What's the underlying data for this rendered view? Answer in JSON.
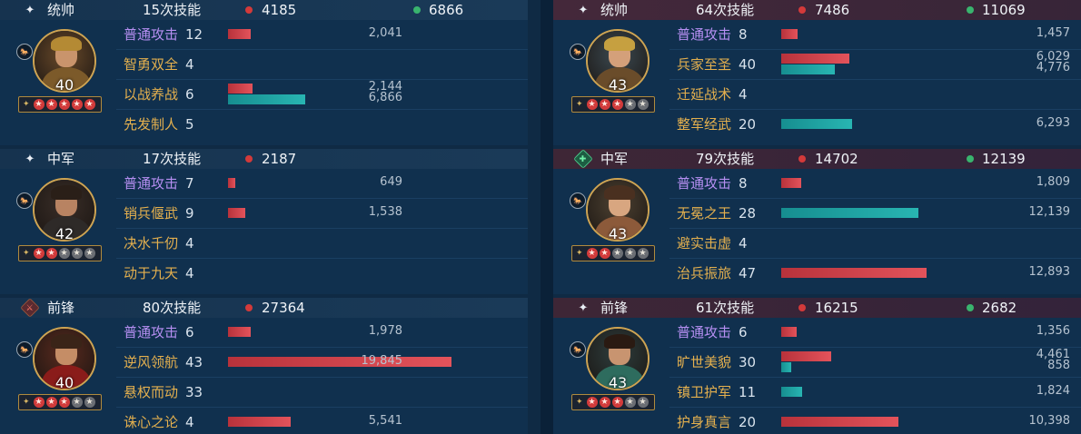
{
  "star_colors": {
    "on": "#d23b3b",
    "off": "#6b6e74"
  },
  "bar_colors": {
    "damage": "#d43a3a",
    "heal": "#1fa3a3"
  },
  "left": [
    {
      "role": "统帅",
      "role_icon": "sparkle-icon",
      "skills": "15次技能",
      "damage": "4185",
      "heal": "6866",
      "level": "40",
      "stars_on": 5,
      "stars_total": 5,
      "rows": [
        {
          "name": "普通攻击",
          "count": "12",
          "dmg": 2041,
          "dmg_text": "2,041",
          "heal": null,
          "heal_text": "",
          "basic": true
        },
        {
          "name": "智勇双全",
          "count": "4",
          "dmg": null,
          "dmg_text": "",
          "heal": null,
          "heal_text": ""
        },
        {
          "name": "以战养战",
          "count": "6",
          "dmg": 2144,
          "dmg_text": "2,144",
          "heal": 6866,
          "heal_text": "6,866"
        },
        {
          "name": "先发制人",
          "count": "5",
          "dmg": null,
          "dmg_text": "",
          "heal": null,
          "heal_text": ""
        }
      ]
    },
    {
      "role": "中军",
      "role_icon": "sparkle-icon",
      "skills": "17次技能",
      "damage": "2187",
      "heal": "",
      "level": "42",
      "stars_on": 2,
      "stars_total": 5,
      "rows": [
        {
          "name": "普通攻击",
          "count": "7",
          "dmg": 649,
          "dmg_text": "649",
          "heal": null,
          "heal_text": "",
          "basic": true
        },
        {
          "name": "销兵偃武",
          "count": "9",
          "dmg": 1538,
          "dmg_text": "1,538",
          "heal": null,
          "heal_text": ""
        },
        {
          "name": "决水千仞",
          "count": "4",
          "dmg": null,
          "dmg_text": "",
          "heal": null,
          "heal_text": ""
        },
        {
          "name": "动于九天",
          "count": "4",
          "dmg": null,
          "dmg_text": "",
          "heal": null,
          "heal_text": ""
        }
      ]
    },
    {
      "role": "前锋",
      "role_icon": "sword-badge-icon",
      "skills": "80次技能",
      "damage": "27364",
      "heal": "",
      "level": "40",
      "stars_on": 3,
      "stars_total": 5,
      "rows": [
        {
          "name": "普通攻击",
          "count": "6",
          "dmg": 1978,
          "dmg_text": "1,978",
          "heal": null,
          "heal_text": "",
          "basic": true
        },
        {
          "name": "逆风领航",
          "count": "43",
          "dmg": 19845,
          "dmg_text": "19,845",
          "heal": null,
          "heal_text": ""
        },
        {
          "name": "悬权而动",
          "count": "33",
          "dmg": null,
          "dmg_text": "",
          "heal": null,
          "heal_text": ""
        },
        {
          "name": "诛心之论",
          "count": "4",
          "dmg": 5541,
          "dmg_text": "5,541",
          "heal": null,
          "heal_text": ""
        }
      ]
    }
  ],
  "right": [
    {
      "role": "统帅",
      "role_icon": "sparkle-icon",
      "skills": "64次技能",
      "damage": "7486",
      "heal": "11069",
      "level": "43",
      "stars_on": 3,
      "stars_total": 5,
      "rows": [
        {
          "name": "普通攻击",
          "count": "8",
          "dmg": 1457,
          "dmg_text": "1,457",
          "heal": null,
          "heal_text": "",
          "basic": true
        },
        {
          "name": "兵家至圣",
          "count": "40",
          "dmg": 6029,
          "dmg_text": "6,029",
          "heal": 4776,
          "heal_text": "4,776"
        },
        {
          "name": "迁延战术",
          "count": "4",
          "dmg": null,
          "dmg_text": "",
          "heal": null,
          "heal_text": ""
        },
        {
          "name": "整军经武",
          "count": "20",
          "dmg": null,
          "dmg_text": "",
          "heal": 6293,
          "heal_text": "6,293"
        }
      ]
    },
    {
      "role": "中军",
      "role_icon": "heart-badge-icon",
      "skills": "79次技能",
      "damage": "14702",
      "heal": "12139",
      "level": "43",
      "stars_on": 2,
      "stars_total": 5,
      "rows": [
        {
          "name": "普通攻击",
          "count": "8",
          "dmg": 1809,
          "dmg_text": "1,809",
          "heal": null,
          "heal_text": "",
          "basic": true
        },
        {
          "name": "无冕之王",
          "count": "28",
          "dmg": null,
          "dmg_text": "",
          "heal": 12139,
          "heal_text": "12,139"
        },
        {
          "name": "避实击虚",
          "count": "4",
          "dmg": null,
          "dmg_text": "",
          "heal": null,
          "heal_text": ""
        },
        {
          "name": "治兵振旅",
          "count": "47",
          "dmg": 12893,
          "dmg_text": "12,893",
          "heal": null,
          "heal_text": ""
        }
      ]
    },
    {
      "role": "前锋",
      "role_icon": "sparkle-icon",
      "skills": "61次技能",
      "damage": "16215",
      "heal": "2682",
      "level": "43",
      "stars_on": 3,
      "stars_total": 5,
      "rows": [
        {
          "name": "普通攻击",
          "count": "6",
          "dmg": 1356,
          "dmg_text": "1,356",
          "heal": null,
          "heal_text": "",
          "basic": true
        },
        {
          "name": "旷世美貌",
          "count": "30",
          "dmg": 4461,
          "dmg_text": "4,461",
          "heal": 858,
          "heal_text": "858"
        },
        {
          "name": "镇卫护军",
          "count": "11",
          "dmg": null,
          "dmg_text": "",
          "heal": 1824,
          "heal_text": "1,824"
        },
        {
          "name": "护身真言",
          "count": "20",
          "dmg": 10398,
          "dmg_text": "10,398",
          "heal": null,
          "heal_text": ""
        }
      ]
    }
  ]
}
